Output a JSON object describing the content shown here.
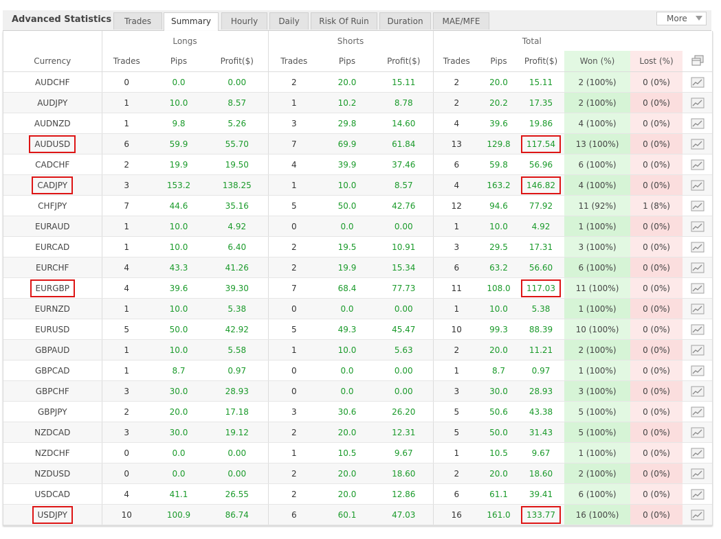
{
  "header": {
    "title": "Advanced Statistics",
    "tabs": [
      "Trades",
      "Summary",
      "Hourly",
      "Daily",
      "Risk Of Ruin",
      "Duration",
      "MAE/MFE"
    ],
    "active_tab": "Summary",
    "more_label": "More"
  },
  "groups": {
    "longs": "Longs",
    "shorts": "Shorts",
    "total": "Total"
  },
  "columns": [
    "Currency",
    "Trades",
    "Pips",
    "Profit($)",
    "Trades",
    "Pips",
    "Profit($)",
    "Trades",
    "Pips",
    "Profit($)",
    "Won (%)",
    "Lost (%)"
  ],
  "rows": [
    {
      "currency": "AUDCHF",
      "l": [
        "0",
        "0.0",
        "0.00"
      ],
      "s": [
        "2",
        "20.0",
        "15.11"
      ],
      "t": [
        "2",
        "20.0",
        "15.11"
      ],
      "won": "2 (100%)",
      "lost": "0 (0%)"
    },
    {
      "currency": "AUDJPY",
      "l": [
        "1",
        "10.0",
        "8.57"
      ],
      "s": [
        "1",
        "10.2",
        "8.78"
      ],
      "t": [
        "2",
        "20.2",
        "17.35"
      ],
      "won": "2 (100%)",
      "lost": "0 (0%)"
    },
    {
      "currency": "AUDNZD",
      "l": [
        "1",
        "9.8",
        "5.26"
      ],
      "s": [
        "3",
        "29.8",
        "14.60"
      ],
      "t": [
        "4",
        "39.6",
        "19.86"
      ],
      "won": "4 (100%)",
      "lost": "0 (0%)"
    },
    {
      "currency": "AUDUSD",
      "l": [
        "6",
        "59.9",
        "55.70"
      ],
      "s": [
        "7",
        "69.9",
        "61.84"
      ],
      "t": [
        "13",
        "129.8",
        "117.54"
      ],
      "won": "13 (100%)",
      "lost": "0 (0%)",
      "highlight": true
    },
    {
      "currency": "CADCHF",
      "l": [
        "2",
        "19.9",
        "19.50"
      ],
      "s": [
        "4",
        "39.9",
        "37.46"
      ],
      "t": [
        "6",
        "59.8",
        "56.96"
      ],
      "won": "6 (100%)",
      "lost": "0 (0%)"
    },
    {
      "currency": "CADJPY",
      "l": [
        "3",
        "153.2",
        "138.25"
      ],
      "s": [
        "1",
        "10.0",
        "8.57"
      ],
      "t": [
        "4",
        "163.2",
        "146.82"
      ],
      "won": "4 (100%)",
      "lost": "0 (0%)",
      "highlight": true
    },
    {
      "currency": "CHFJPY",
      "l": [
        "7",
        "44.6",
        "35.16"
      ],
      "s": [
        "5",
        "50.0",
        "42.76"
      ],
      "t": [
        "12",
        "94.6",
        "77.92"
      ],
      "won": "11 (92%)",
      "lost": "1 (8%)"
    },
    {
      "currency": "EURAUD",
      "l": [
        "1",
        "10.0",
        "4.92"
      ],
      "s": [
        "0",
        "0.0",
        "0.00"
      ],
      "t": [
        "1",
        "10.0",
        "4.92"
      ],
      "won": "1 (100%)",
      "lost": "0 (0%)"
    },
    {
      "currency": "EURCAD",
      "l": [
        "1",
        "10.0",
        "6.40"
      ],
      "s": [
        "2",
        "19.5",
        "10.91"
      ],
      "t": [
        "3",
        "29.5",
        "17.31"
      ],
      "won": "3 (100%)",
      "lost": "0 (0%)"
    },
    {
      "currency": "EURCHF",
      "l": [
        "4",
        "43.3",
        "41.26"
      ],
      "s": [
        "2",
        "19.9",
        "15.34"
      ],
      "t": [
        "6",
        "63.2",
        "56.60"
      ],
      "won": "6 (100%)",
      "lost": "0 (0%)"
    },
    {
      "currency": "EURGBP",
      "l": [
        "4",
        "39.6",
        "39.30"
      ],
      "s": [
        "7",
        "68.4",
        "77.73"
      ],
      "t": [
        "11",
        "108.0",
        "117.03"
      ],
      "won": "11 (100%)",
      "lost": "0 (0%)",
      "highlight": true
    },
    {
      "currency": "EURNZD",
      "l": [
        "1",
        "10.0",
        "5.38"
      ],
      "s": [
        "0",
        "0.0",
        "0.00"
      ],
      "t": [
        "1",
        "10.0",
        "5.38"
      ],
      "won": "1 (100%)",
      "lost": "0 (0%)"
    },
    {
      "currency": "EURUSD",
      "l": [
        "5",
        "50.0",
        "42.92"
      ],
      "s": [
        "5",
        "49.3",
        "45.47"
      ],
      "t": [
        "10",
        "99.3",
        "88.39"
      ],
      "won": "10 (100%)",
      "lost": "0 (0%)"
    },
    {
      "currency": "GBPAUD",
      "l": [
        "1",
        "10.0",
        "5.58"
      ],
      "s": [
        "1",
        "10.0",
        "5.63"
      ],
      "t": [
        "2",
        "20.0",
        "11.21"
      ],
      "won": "2 (100%)",
      "lost": "0 (0%)"
    },
    {
      "currency": "GBPCAD",
      "l": [
        "1",
        "8.7",
        "0.97"
      ],
      "s": [
        "0",
        "0.0",
        "0.00"
      ],
      "t": [
        "1",
        "8.7",
        "0.97"
      ],
      "won": "1 (100%)",
      "lost": "0 (0%)"
    },
    {
      "currency": "GBPCHF",
      "l": [
        "3",
        "30.0",
        "28.93"
      ],
      "s": [
        "0",
        "0.0",
        "0.00"
      ],
      "t": [
        "3",
        "30.0",
        "28.93"
      ],
      "won": "3 (100%)",
      "lost": "0 (0%)"
    },
    {
      "currency": "GBPJPY",
      "l": [
        "2",
        "20.0",
        "17.18"
      ],
      "s": [
        "3",
        "30.6",
        "26.20"
      ],
      "t": [
        "5",
        "50.6",
        "43.38"
      ],
      "won": "5 (100%)",
      "lost": "0 (0%)"
    },
    {
      "currency": "NZDCAD",
      "l": [
        "3",
        "30.0",
        "19.12"
      ],
      "s": [
        "2",
        "20.0",
        "12.31"
      ],
      "t": [
        "5",
        "50.0",
        "31.43"
      ],
      "won": "5 (100%)",
      "lost": "0 (0%)"
    },
    {
      "currency": "NZDCHF",
      "l": [
        "0",
        "0.0",
        "0.00"
      ],
      "s": [
        "1",
        "10.5",
        "9.67"
      ],
      "t": [
        "1",
        "10.5",
        "9.67"
      ],
      "won": "1 (100%)",
      "lost": "0 (0%)"
    },
    {
      "currency": "NZDUSD",
      "l": [
        "0",
        "0.0",
        "0.00"
      ],
      "s": [
        "2",
        "20.0",
        "18.60"
      ],
      "t": [
        "2",
        "20.0",
        "18.60"
      ],
      "won": "2 (100%)",
      "lost": "0 (0%)"
    },
    {
      "currency": "USDCAD",
      "l": [
        "4",
        "41.1",
        "26.55"
      ],
      "s": [
        "2",
        "20.0",
        "12.86"
      ],
      "t": [
        "6",
        "61.1",
        "39.41"
      ],
      "won": "6 (100%)",
      "lost": "0 (0%)"
    },
    {
      "currency": "USDJPY",
      "l": [
        "10",
        "100.9",
        "86.74"
      ],
      "s": [
        "6",
        "60.1",
        "47.03"
      ],
      "t": [
        "16",
        "161.0",
        "133.77"
      ],
      "won": "16 (100%)",
      "lost": "0 (0%)",
      "highlight": true
    }
  ],
  "colors": {
    "positive": "#1a9a2a",
    "highlight_border": "#dd1414",
    "won_bg": "#e2f8e2",
    "lost_bg": "#fde9e9"
  }
}
